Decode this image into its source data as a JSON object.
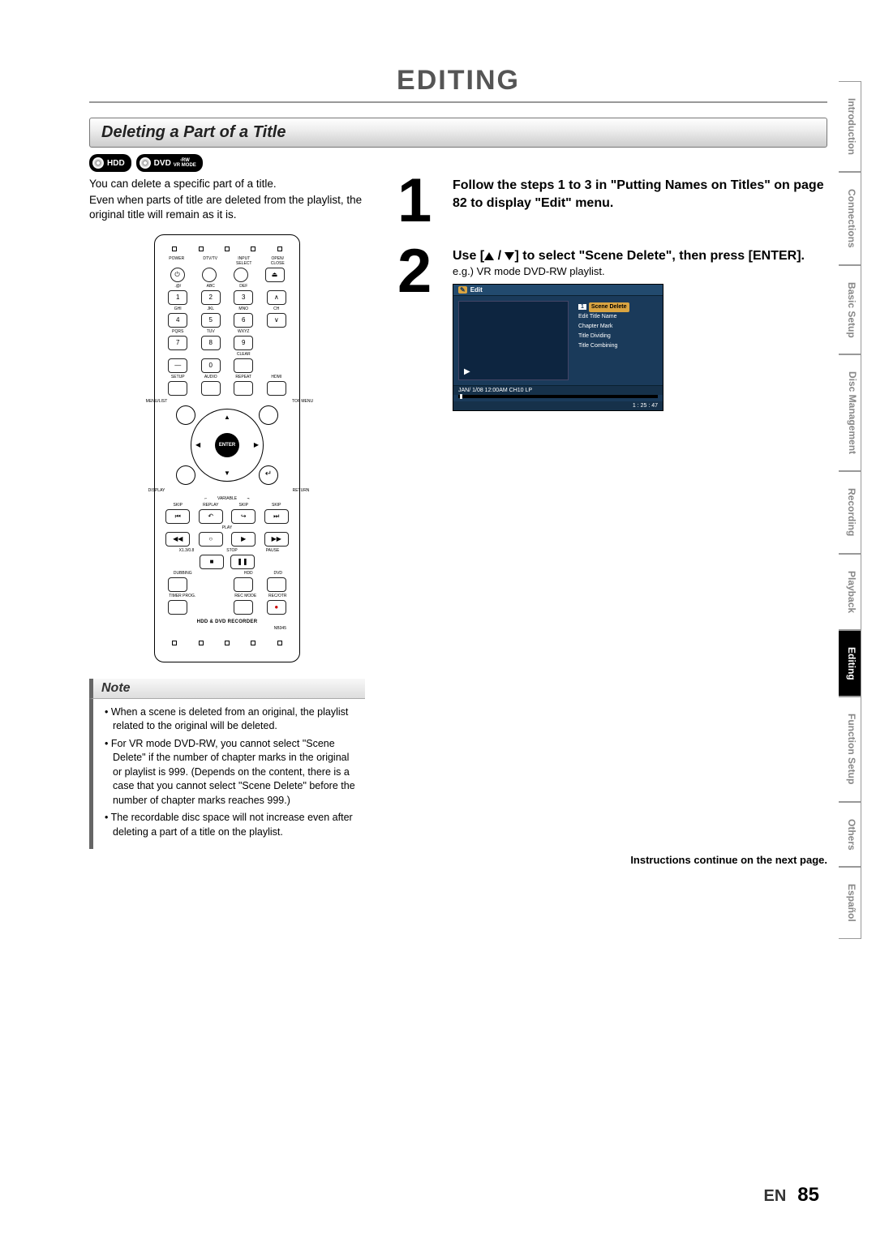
{
  "page_title": "EDITING",
  "section_title": "Deleting a Part of a Title",
  "media_badges": {
    "hdd": "HDD",
    "dvd": "DVD",
    "dvd_sub": "-RW",
    "dvd_mode": "VR MODE"
  },
  "intro": {
    "line1": "You can delete a specific part of a title.",
    "line2": "Even when parts of title are deleted from the playlist, the original title will remain as it is."
  },
  "remote": {
    "power": "POWER",
    "dtvtv": "DTV/TV",
    "input": "INPUT SELECT",
    "open": "OPEN/\nCLOSE",
    "row1_lbl": [
      ".@/",
      "ABC",
      "DEF"
    ],
    "row2_lbl": [
      "GHI",
      "JKL",
      "MNO",
      "CH"
    ],
    "row3_lbl": [
      "PQRS",
      "TUV",
      "WXYZ"
    ],
    "clear": "CLEAR",
    "setup": "SETUP",
    "audio": "AUDIO",
    "repeat": "REPEAT",
    "hdmi": "HDMI",
    "menulist": "MENU/LIST",
    "topmenu": "TOP MENU",
    "display": "DISPLAY",
    "return": "RETURN",
    "enter": "ENTER",
    "variable": "VARIABLE",
    "skip": "SKIP",
    "replay": "REPLAY",
    "play": "PLAY",
    "stop": "STOP",
    "pause": "PAUSE",
    "x13": "X1.3/0.8",
    "dubbing": "DUBBING",
    "hdd": "HDD",
    "dvd": "DVD",
    "timer": "TIMER PROG.",
    "recmode": "REC MODE",
    "recotr": "REC/OTR",
    "brand": "HDD & DVD RECORDER",
    "model": "NB345",
    "n0": "0",
    "n1": "1",
    "n2": "2",
    "n3": "3",
    "n4": "4",
    "n5": "5",
    "n6": "6",
    "n7": "7",
    "n8": "8",
    "n9": "9"
  },
  "note": {
    "heading": "Note",
    "items": [
      "When a scene is deleted from an original, the playlist related to the original will be deleted.",
      "For VR mode DVD-RW, you cannot select \"Scene Delete\" if the number of chapter marks in the original or playlist is 999. (Depends on the content, there is a case that you cannot select \"Scene Delete\" before the number of chapter marks reaches 999.)",
      "The recordable disc space will not increase even after deleting a part of a title on the playlist."
    ]
  },
  "steps": {
    "s1": "Follow the steps 1 to 3 in \"Putting Names on Titles\" on page 82 to display \"Edit\" menu.",
    "s2a": "Use [",
    "s2b": " / ",
    "s2c": "] to select \"Scene Delete\", then press [ENTER].",
    "s2_eg": "e.g.) VR mode DVD-RW playlist."
  },
  "osd": {
    "head": "Edit",
    "menu_num": "1",
    "items": [
      "Scene Delete",
      "Edit Title Name",
      "Chapter Mark",
      "Title Dividing",
      "Title Combining"
    ],
    "foot_left": "JAN/ 1/08 12:00AM CH10   LP",
    "foot_right": "1 : 25 : 47"
  },
  "continue_text": "Instructions continue on the next page.",
  "side_tabs": [
    "Introduction",
    "Connections",
    "Basic Setup",
    "Disc Management",
    "Recording",
    "Playback",
    "Editing",
    "Function Setup",
    "Others",
    "Español"
  ],
  "active_tab_index": 6,
  "footer": {
    "lang": "EN",
    "page": "85"
  }
}
